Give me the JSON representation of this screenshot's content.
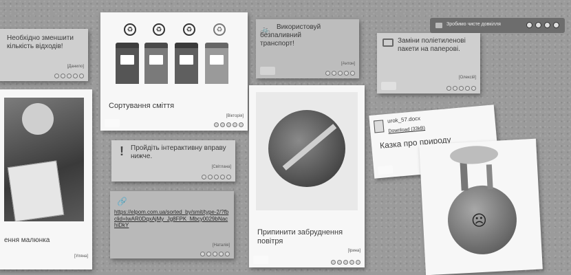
{
  "toolbar": {
    "label": "Зробимо чисте довкілля"
  },
  "cards": {
    "reduce_waste": {
      "text": "Необхідно зменшити кількість відходів!",
      "tag": "[Данило]"
    },
    "sorting": {
      "caption": "Сортування сміття",
      "tag": "[Вікторія]"
    },
    "transport": {
      "text": "Використовуй безпаливний транспорт!",
      "tag": "[Антон]"
    },
    "bags": {
      "text": "Заміни поліетиленові пакети на паперові.",
      "tag": "[Олексій]"
    },
    "drawing": {
      "caption": "ення малюнка",
      "tag": "[Уляна]"
    },
    "exercise": {
      "text": "Пройдіть інтерактивну вправу нижче.",
      "tag": "[Світлана]"
    },
    "pollution": {
      "caption": "Припинити забруднення повітря",
      "tag": "[Ірина]"
    },
    "link": {
      "url": "https://elpom.com.ua/sorted_by/smit/type-2/?fbclid=IwAR0DqxAjMy_Jg8FPK_Mbcy0029bNachiDkY",
      "tag": "[Наталія]"
    },
    "file": {
      "name": "urok_57.docx",
      "download": "Download (33kB)",
      "title": "Казка про природу"
    }
  },
  "colors": {
    "background": "#9b9b9b",
    "note": "#cfcfcf",
    "card": "#f7f7f7"
  }
}
